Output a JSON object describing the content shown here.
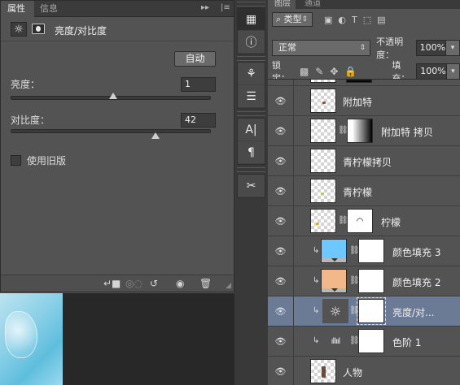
{
  "properties": {
    "tabs": [
      "属性",
      "信息"
    ],
    "title": "亮度/对比度",
    "auto_label": "自动",
    "brightness_label": "亮度：",
    "brightness_value": "1",
    "brightness_fraction": 0.51,
    "contrast_label": "对比度：",
    "contrast_value": "42",
    "contrast_fraction": 0.72,
    "legacy_label": "使用旧版"
  },
  "layers_panel": {
    "tabs": [
      "图层",
      "通道"
    ],
    "filter_type": "类型",
    "blend_mode": "正常",
    "opacity_label": "不透明度：",
    "opacity_value": "100%",
    "lock_label": "锁定：",
    "fill_label": "填充：",
    "fill_value": "100%",
    "layers": [
      {
        "name": "",
        "kind": "partial",
        "selected": false
      },
      {
        "name": "附加特",
        "kind": "image",
        "selected": false
      },
      {
        "name": "附加特 拷贝",
        "kind": "image-mask",
        "selected": false
      },
      {
        "name": "青柠檬拷贝",
        "kind": "image",
        "selected": false
      },
      {
        "name": "青柠檬",
        "kind": "image",
        "selected": false
      },
      {
        "name": "柠檬",
        "kind": "image-mask",
        "selected": false
      },
      {
        "name": "颜色填充 3",
        "kind": "fill",
        "color": "#6fc7ff",
        "selected": false
      },
      {
        "name": "颜色填充 2",
        "kind": "fill",
        "color": "#f3b88a",
        "selected": false
      },
      {
        "name": "亮度/对...",
        "kind": "adjustment",
        "selected": true
      },
      {
        "name": "色阶 1",
        "kind": "levels",
        "selected": false
      },
      {
        "name": "人物",
        "kind": "image",
        "selected": false
      }
    ]
  },
  "colors": {
    "panel_bg": "#535353",
    "selected_row": "#6b7b95",
    "fill3": "#6fc7ff",
    "fill2": "#f3b88a"
  }
}
